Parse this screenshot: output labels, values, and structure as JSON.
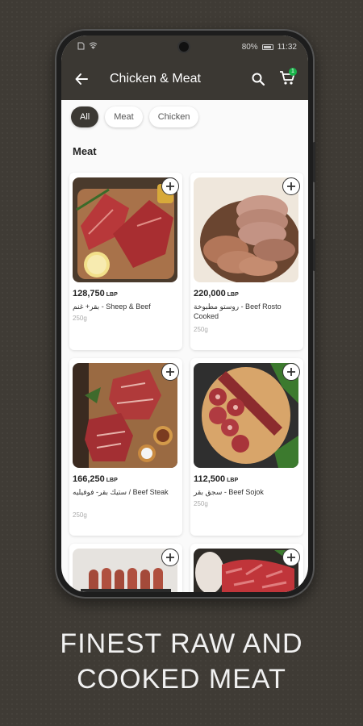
{
  "status": {
    "battery": "80%",
    "time": "11:32"
  },
  "header": {
    "title": "Chicken & Meat",
    "cart_count": "1"
  },
  "filters": [
    {
      "label": "All",
      "active": true
    },
    {
      "label": "Meat",
      "active": false
    },
    {
      "label": "Chicken",
      "active": false
    }
  ],
  "section": {
    "title": "Meat"
  },
  "products": [
    {
      "price": "128,750",
      "currency": "LBP",
      "name": "بقر+ غنم - Sheep & Beef",
      "weight": "250g"
    },
    {
      "price": "220,000",
      "currency": "LBP",
      "name": "روستو مطبوخة - Beef Rosto Cooked",
      "weight": "250g"
    },
    {
      "price": "166,250",
      "currency": "LBP",
      "name": "ستيك بقر- فوفيليه / Beef Steak",
      "weight": "250g"
    },
    {
      "price": "112,500",
      "currency": "LBP",
      "name": "سجق بقر - Beef Sojok",
      "weight": "250g"
    }
  ],
  "promo": {
    "line1": "FINEST RAW AND",
    "line2": "COOKED MEAT"
  },
  "icons": {
    "back": "back-arrow-icon",
    "search": "search-icon",
    "cart": "cart-icon",
    "add": "plus-icon"
  }
}
